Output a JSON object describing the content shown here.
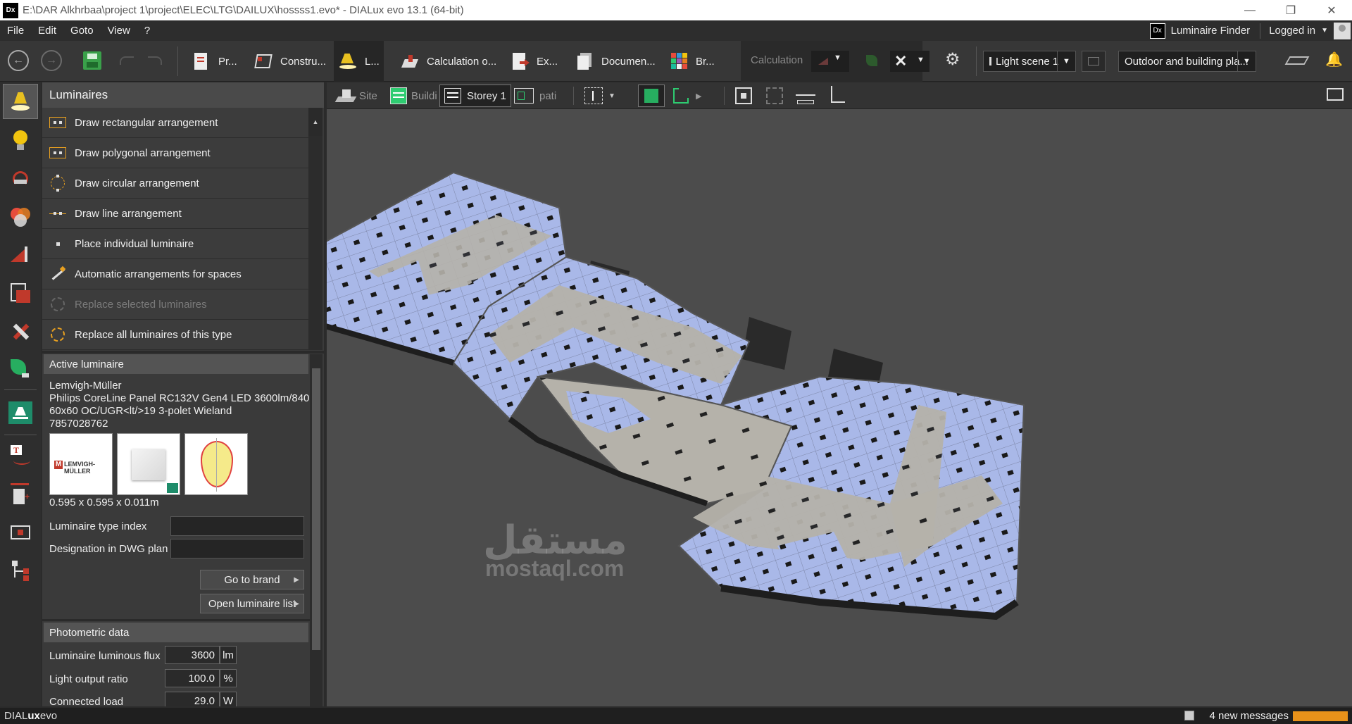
{
  "window": {
    "logo": "Dx",
    "title": "E:\\DAR Alkhrbaa\\project 1\\project\\ELEC\\LTG\\DAILUX\\hossss1.evo* - DIALux evo 13.1  (64-bit)",
    "minimize": "—",
    "restore": "❐",
    "close": "✕"
  },
  "menu": {
    "items": [
      "File",
      "Edit",
      "Goto",
      "View",
      "?"
    ],
    "finder_logo": "Dx",
    "finder_label": "Luminaire Finder",
    "logged_in": "Logged in",
    "caret": "▼"
  },
  "toolbar": {
    "back": "←",
    "forward": "→",
    "tabs": [
      {
        "label": "Pr..."
      },
      {
        "label": "Constru..."
      },
      {
        "label": "L..."
      },
      {
        "label": "Calculation o..."
      },
      {
        "label": "Ex..."
      },
      {
        "label": "Documen..."
      },
      {
        "label": "Br..."
      }
    ],
    "calculation_label": "Calculation",
    "cancel_glyph": "✕",
    "settings_glyph": "⚙",
    "dropdown_caret": "▼",
    "light_scene": "Light scene 1",
    "outdoor": "Outdoor and building pla...",
    "bell": "🔔"
  },
  "panel": {
    "title": "Luminaires",
    "scroll_up": "▲",
    "commands": [
      {
        "label": "Draw rectangular arrangement",
        "enabled": true
      },
      {
        "label": "Draw polygonal arrangement",
        "enabled": true
      },
      {
        "label": "Draw circular arrangement",
        "enabled": true
      },
      {
        "label": "Draw line arrangement",
        "enabled": true
      },
      {
        "label": "Place individual luminaire",
        "enabled": true
      },
      {
        "label": "Automatic arrangements for spaces",
        "enabled": true
      },
      {
        "label": "Replace selected luminaires",
        "enabled": false
      },
      {
        "label": "Replace all luminaires of this type",
        "enabled": true
      }
    ],
    "active_luminaire": {
      "header": "Active luminaire",
      "manufacturer": "Lemvigh-Müller",
      "name_line1": "Philips CoreLine Panel RC132V Gen4 LED 3600lm/840",
      "name_line2": "60x60 OC/UGR<lt/>19 3-polet Wieland",
      "article": "7857028762",
      "brand_logo_text": "LEMVIGH-MÜLLER",
      "brand_logo_mark": "M",
      "dimensions": "0.595 x 0.595 x 0.011m",
      "type_index_label": "Luminaire type index",
      "type_index_value": "",
      "designation_label": "Designation in DWG plan",
      "designation_value": "",
      "go_to_brand": "Go to brand",
      "open_list": "Open luminaire list",
      "arrow": "▶"
    },
    "photometric": {
      "header": "Photometric data",
      "rows": [
        {
          "label": "Luminaire luminous flux",
          "value": "3600",
          "unit": "lm"
        },
        {
          "label": "Light output ratio",
          "value": "100.0",
          "unit": "%"
        },
        {
          "label": "Connected load",
          "value": "29.0",
          "unit": "W"
        }
      ]
    }
  },
  "viewport_toolbar": {
    "site": "Site",
    "building": "Buildi",
    "storey": "Storey 1",
    "path": "pati",
    "caret": "▼",
    "play": "▶"
  },
  "statusbar": {
    "brand_a": "DIAL",
    "brand_b": "ux",
    "brand_c": "evo",
    "messages": "4 new messages"
  },
  "watermark": {
    "arabic": "مستقل",
    "latin": "mostaql.com"
  },
  "colors": {
    "accent": "#e8921a",
    "room_lit": "#a9b8e8",
    "corridor": "#b5b2aa"
  }
}
